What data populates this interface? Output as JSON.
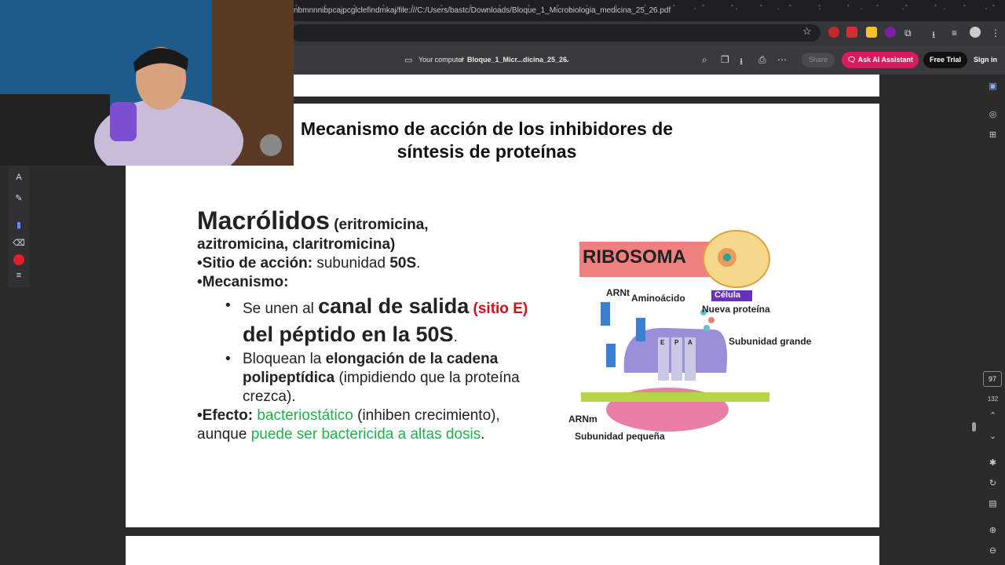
{
  "browser": {
    "url": "nbmnnnibpcajpcglclefindmkaj/file:///C:/Users/bastc/Downloads/Bloque_1_Microbiologia_medicina_25_26.pdf"
  },
  "viewer_toolbar": {
    "location": "Your computer",
    "separator": "/",
    "file_name": "Bloque_1_Micr...dicina_25_26",
    "share_label": "Share",
    "ai_label": "Ask AI Assistant",
    "trial_label": "Free Trial",
    "signin_label": "Sign in"
  },
  "page_nav": {
    "current_page": "97",
    "total_pages": "132"
  },
  "slide": {
    "title_line1": "Mecanismo de acción de los inhibidores de",
    "title_line2": "síntesis de proteínas",
    "heading": "Macrólidos",
    "drugs_part1": "(eritromicina,",
    "drugs_part2": "azitromicina, claritromicina)",
    "site_label": "•Sitio de acción:",
    "site_text": " subunidad ",
    "site_value": "50S",
    "site_end": ".",
    "mech_label": "•Mecanismo:",
    "b1_dot": "•",
    "b1_pre": "Se unen al ",
    "b1_big": "canal de salida",
    "b1_red": " (sitio E)",
    "b1_big2": " del péptido en la 50S",
    "b1_end": ".",
    "b2_dot": "•",
    "b2_pre": "Bloquean la ",
    "b2_bold": "elongación de la cadena polipeptídica",
    "b2_post": " (impidiendo que la proteína crezca).",
    "effect_label": "•Efecto:",
    "effect_green1": " bacteriostático",
    "effect_mid": " (inhiben crecimiento), aunque ",
    "effect_green2": "puede ser bactericida a altas dosis",
    "effect_end": "."
  },
  "ribosome_figure": {
    "banner": "RIBOSOMA",
    "cell_label": "Célula",
    "arnt": "ARNt",
    "aminoacid": "Aminoácido",
    "new_protein": "Nueva proteína",
    "large_subunit": "Subunidad grande",
    "mrna": "ARNm",
    "small_subunit": "Subunidad pequeña",
    "site_e": "E",
    "site_p": "P",
    "site_a": "A"
  },
  "colors": {
    "ai_button": "#d81b60",
    "green_text": "#22b14c",
    "red_text": "#d0101a",
    "ribosome_banner": "#f08080",
    "cell_label_bg": "#6a2fbf"
  }
}
